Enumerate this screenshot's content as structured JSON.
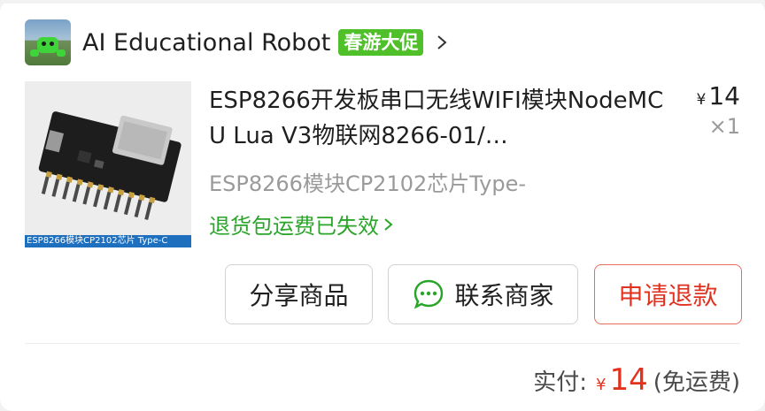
{
  "shop": {
    "name": "AI Educational Robot",
    "promo_badge": "春游大促"
  },
  "product": {
    "title": "ESP8266开发板串口无线WIFI模块NodeMCU Lua V3物联网8266-01/…",
    "sku": "ESP8266模块CP2102芯片Type-",
    "thumbnail_caption": "ESP8266模块CP2102芯片 Type-C",
    "unit_price_symbol": "¥",
    "unit_price": "14",
    "quantity": "×1",
    "refund_note": "退货包运费已失效"
  },
  "actions": {
    "share_label": "分享商品",
    "contact_label": "联系商家",
    "refund_label": "申请退款"
  },
  "payment": {
    "label": "实付:",
    "currency_symbol": "¥",
    "amount": "14",
    "shipping_note": "(免运费)"
  },
  "colors": {
    "promo_green": "#4fbf2a",
    "refund_note_green": "#2aa52a",
    "price_red": "#e0321f"
  }
}
